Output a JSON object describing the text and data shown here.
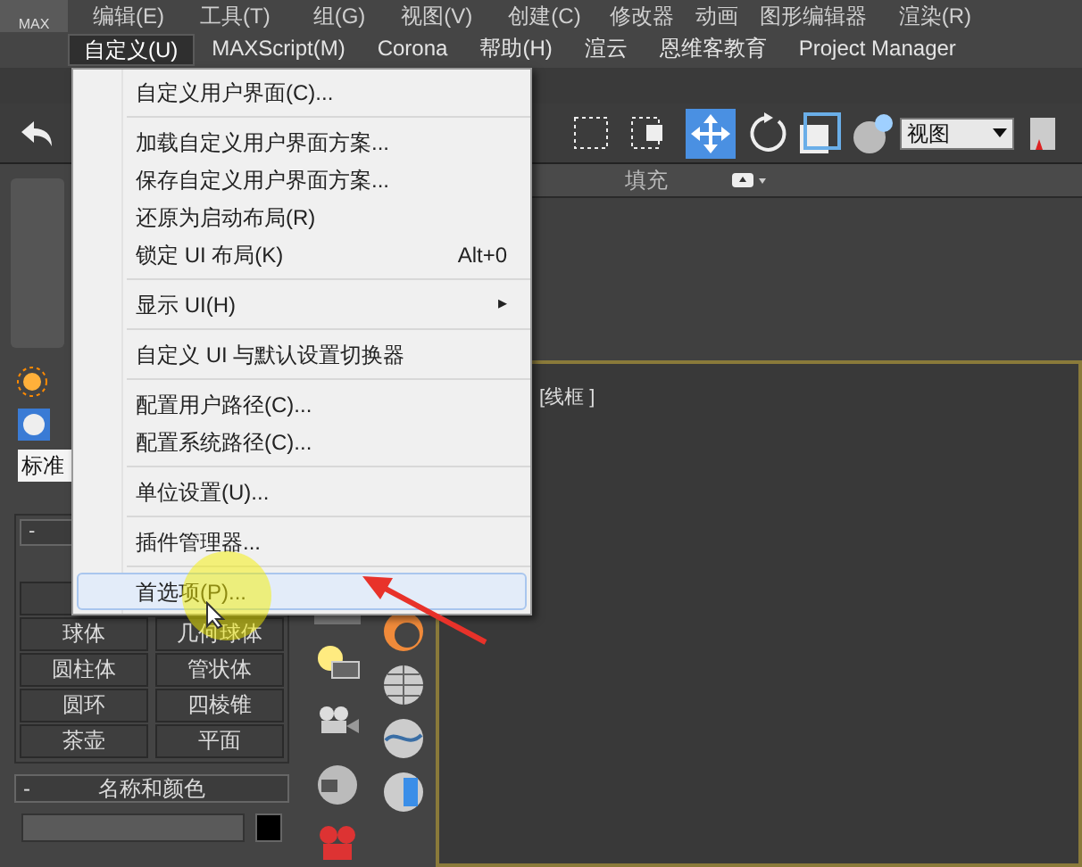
{
  "app_logo": "MAX",
  "menubar": {
    "row_1": [
      "编辑(E)",
      "工具(T)",
      "组(G)",
      "视图(V)",
      "创建(C)",
      "修改器",
      "动画",
      "图形编辑器",
      "渲染(R)"
    ],
    "row_2": [
      {
        "label": "自定义(U)",
        "selected": true
      },
      {
        "label": "MAXScript(M)",
        "selected": false
      },
      {
        "label": "Corona",
        "selected": false
      },
      {
        "label": "帮助(H)",
        "selected": false
      },
      {
        "label": "渲云",
        "selected": false
      },
      {
        "label": "恩维客教育",
        "selected": false
      },
      {
        "label": "Project Manager",
        "selected": false
      }
    ]
  },
  "toolbar": {
    "view_dropdown": "视图"
  },
  "ribbon_tabs": [
    "填充"
  ],
  "menu": {
    "items": [
      {
        "kind": "item",
        "label": "自定义用户界面(C)...",
        "selected": false
      },
      {
        "kind": "separator"
      },
      {
        "kind": "item",
        "label": "加载自定义用户界面方案...",
        "selected": false
      },
      {
        "kind": "item",
        "label": "保存自定义用户界面方案...",
        "selected": false
      },
      {
        "kind": "item",
        "label": "还原为启动布局(R)",
        "selected": false
      },
      {
        "kind": "item",
        "label": "锁定 UI 布局(K)",
        "shortcut": "Alt+0",
        "selected": false
      },
      {
        "kind": "separator"
      },
      {
        "kind": "submenu",
        "label": "显示 UI(H)",
        "arrow": "▸",
        "selected": false
      },
      {
        "kind": "separator"
      },
      {
        "kind": "item",
        "label": "自定义 UI 与默认设置切换器",
        "selected": false
      },
      {
        "kind": "separator"
      },
      {
        "kind": "item",
        "label": "配置用户路径(C)...",
        "selected": false
      },
      {
        "kind": "item",
        "label": "配置系统路径(C)...",
        "selected": false
      },
      {
        "kind": "separator"
      },
      {
        "kind": "item",
        "label": "单位设置(U)...",
        "selected": false
      },
      {
        "kind": "separator"
      },
      {
        "kind": "item",
        "label": "插件管理器...",
        "selected": false
      },
      {
        "kind": "separator"
      },
      {
        "kind": "item",
        "label": "首选项(P)...",
        "selected": true
      }
    ]
  },
  "command_panel": {
    "category_dropdown": "标准",
    "object_type_rollout": {
      "toggle": "-",
      "buttons": [
        "球体",
        "几何球体",
        "圆柱体",
        "管状体",
        "圆环",
        "四棱锥",
        "茶壶",
        "平面"
      ]
    },
    "name_color_rollout": {
      "toggle": "-",
      "title": "名称和颜色"
    }
  },
  "viewport": {
    "label": "[线框 ]"
  }
}
